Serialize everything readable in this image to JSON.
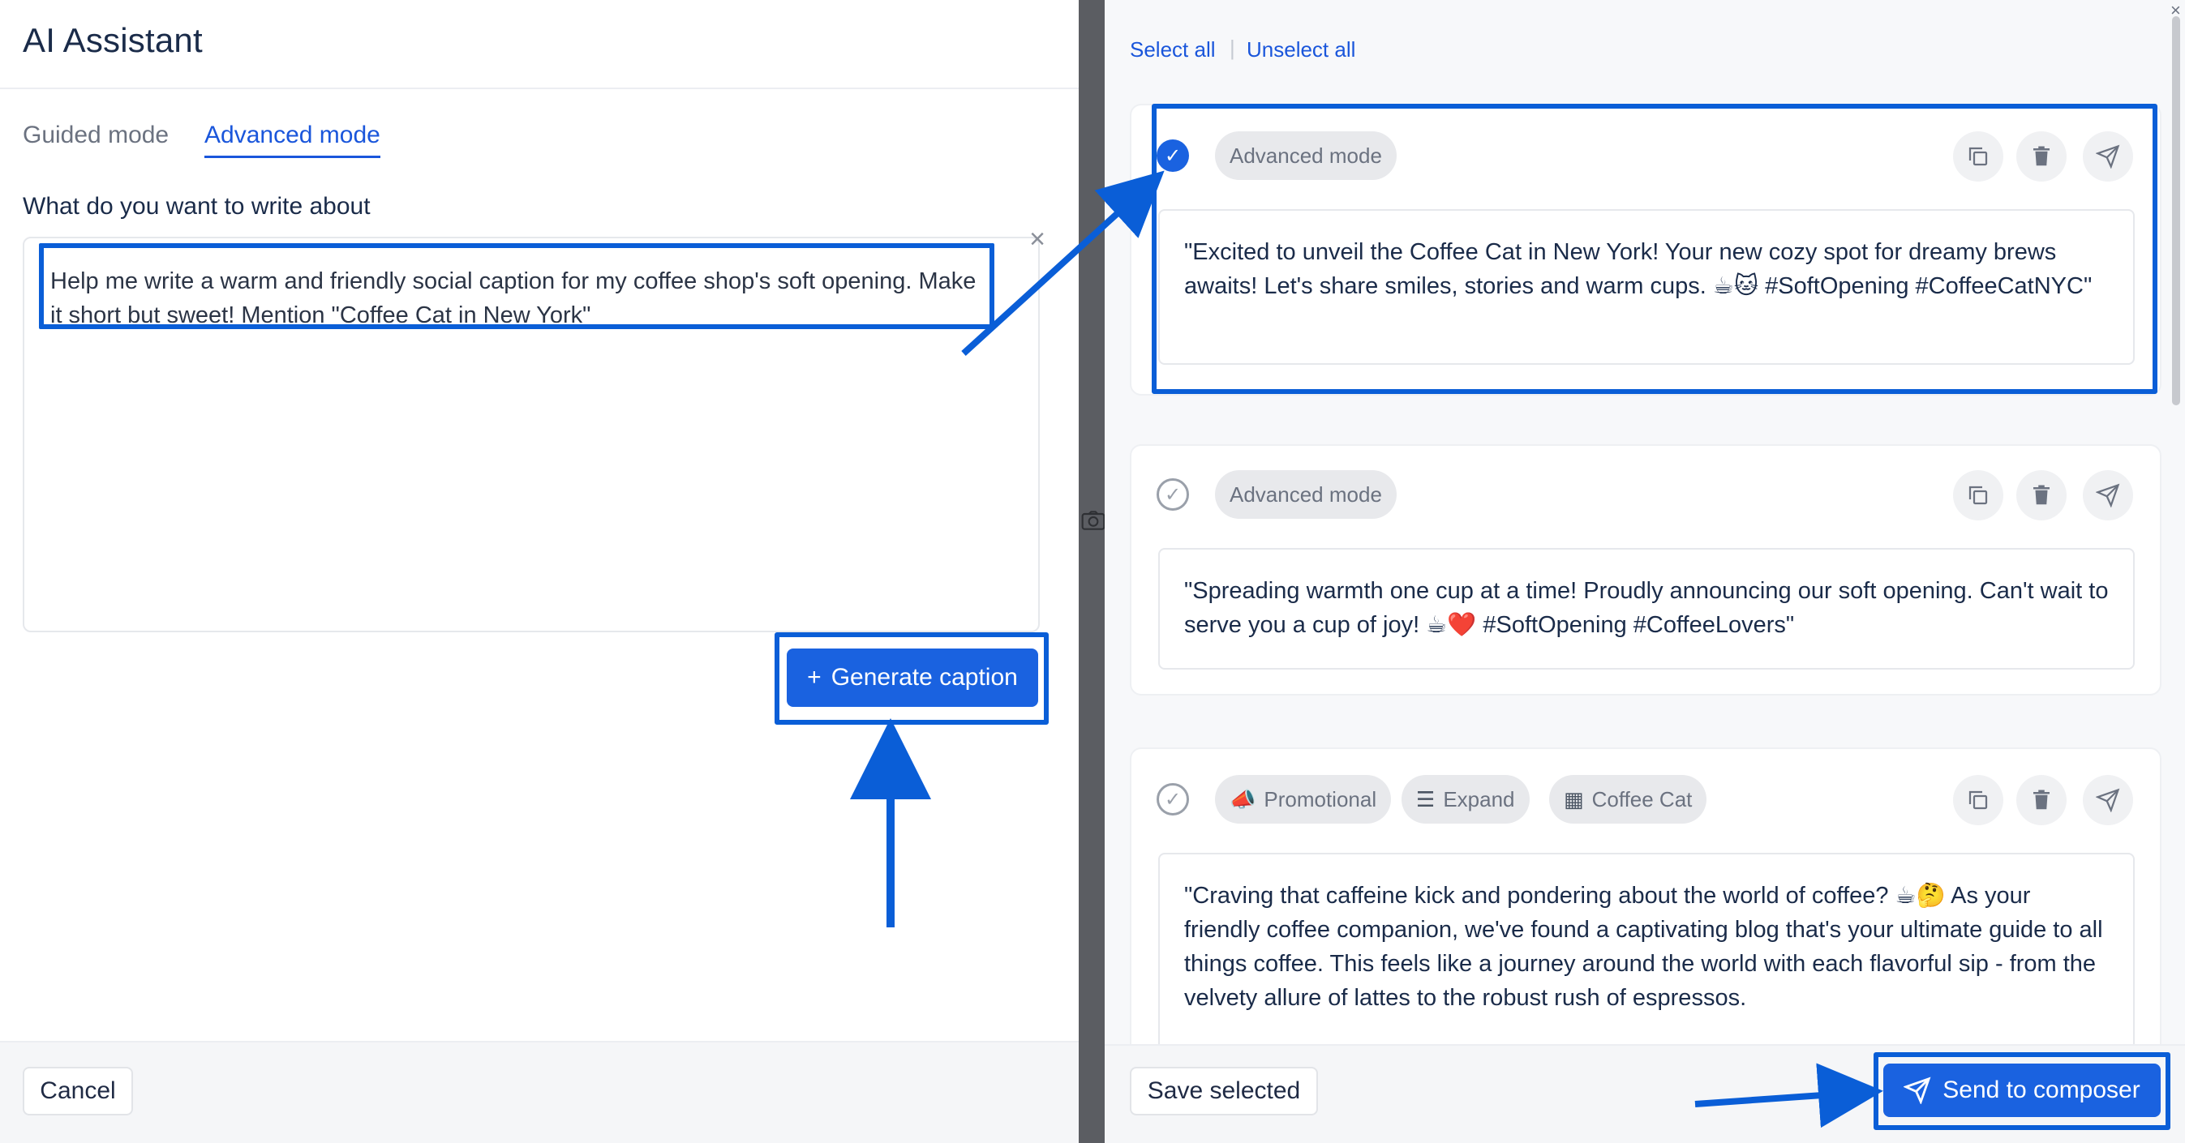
{
  "app": {
    "title": "AI Assistant"
  },
  "tabs": [
    {
      "label": "Guided mode",
      "active": false
    },
    {
      "label": "Advanced mode",
      "active": true
    }
  ],
  "prompt": {
    "label": "What do you want to write about",
    "text": "Help me write a warm and friendly social caption for my coffee shop's soft opening. Make it short but sweet! Mention \"Coffee Cat in New York\""
  },
  "buttons": {
    "generate": "Generate caption",
    "cancel": "Cancel",
    "save_selected": "Save selected",
    "send_to_composer": "Send to composer"
  },
  "selection": {
    "select_all": "Select all",
    "unselect_all": "Unselect all"
  },
  "results": [
    {
      "selected": true,
      "tags": [
        "Advanced mode"
      ],
      "caption": "\"Excited to unveil the Coffee Cat in New York! Your new cozy spot for dreamy brews awaits! Let's share smiles, stories and warm cups. ☕🐱 #SoftOpening #CoffeeCatNYC\""
    },
    {
      "selected": false,
      "tags": [
        "Advanced mode"
      ],
      "caption": "\"Spreading warmth one cup at a time! Proudly announcing our soft opening. Can't wait to serve you a cup of joy! ☕❤️ #SoftOpening #CoffeeLovers\""
    },
    {
      "selected": false,
      "tags": [
        "Promotional",
        "Expand",
        "Coffee Cat"
      ],
      "caption": "\"Craving that caffeine kick and pondering about the world of coffee? ☕🤔 As your friendly coffee companion, we've found a captivating blog that's your ultimate guide to all things coffee. This feels like a journey around the world with each flavorful sip - from the velvety allure of lattes to the robust rush of espressos."
    }
  ],
  "colors": {
    "accent": "#1a62e0",
    "highlight": "#0a5ed7"
  },
  "icons": {
    "copy": "copy-icon",
    "delete": "trash-icon",
    "send": "send-icon",
    "check": "check-icon",
    "close": "close-icon",
    "sparkle": "sparkle-icon",
    "megaphone": "megaphone-icon",
    "expand": "lines-icon",
    "building": "building-icon",
    "camera": "camera-icon"
  }
}
